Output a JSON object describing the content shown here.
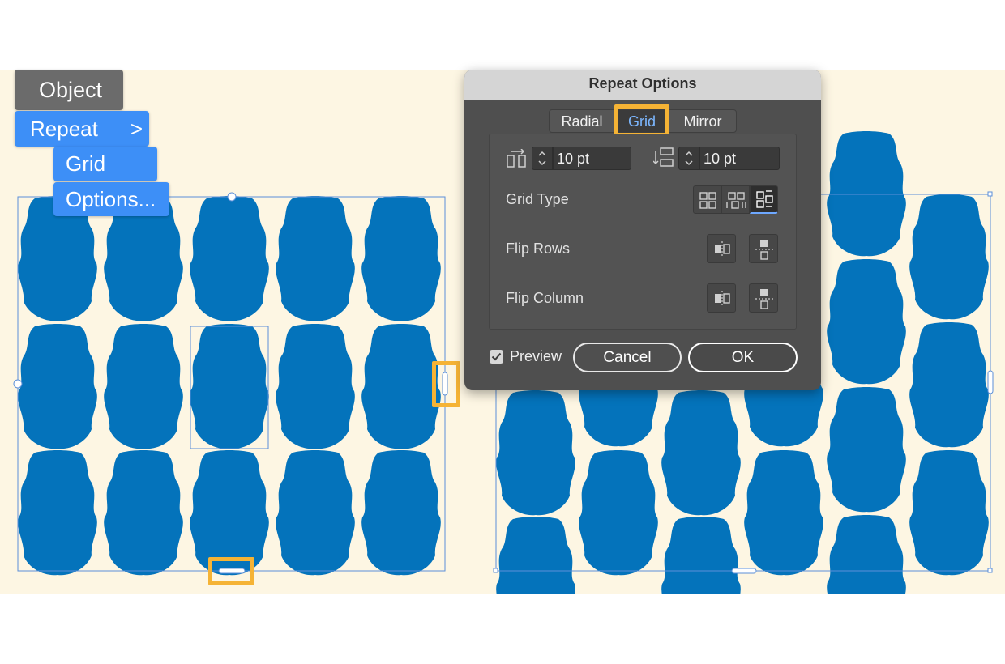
{
  "menu": {
    "object_label": "Object",
    "repeat_label": "Repeat",
    "repeat_chevron": ">",
    "grid_label": "Grid",
    "options_label": "Options..."
  },
  "dialog": {
    "title": "Repeat Options",
    "tabs": [
      {
        "label": "Radial"
      },
      {
        "label": "Grid",
        "selected": true
      },
      {
        "label": "Mirror"
      }
    ],
    "horizontal_spacing": "10 pt",
    "vertical_spacing": "10 pt",
    "grid_type_label": "Grid Type",
    "flip_rows_label": "Flip Rows",
    "flip_column_label": "Flip Column",
    "preview_label": "Preview",
    "preview_checked": true,
    "cancel_label": "Cancel",
    "ok_label": "OK"
  },
  "icons": {
    "submenu": "chevron-right-icon",
    "horizontal_spacing": "horizontal-spacing-icon",
    "vertical_spacing": "vertical-spacing-icon",
    "stepper": "stepper-arrows-icon",
    "grid_type_1": "grid-type-grid-icon",
    "grid_type_2": "grid-type-brick-by-row-icon",
    "grid_type_3": "grid-type-brick-by-column-icon",
    "flip_horizontal": "flip-horizontal-icon",
    "flip_vertical": "flip-vertical-icon",
    "checkmark": "checkmark-icon"
  },
  "colors": {
    "canvas_bg": "#fdf6e3",
    "shape_fill": "#0473bb",
    "menu_blue": "#3d8ff7",
    "highlight": "#f5b335",
    "selection": "#5b8fd8"
  }
}
